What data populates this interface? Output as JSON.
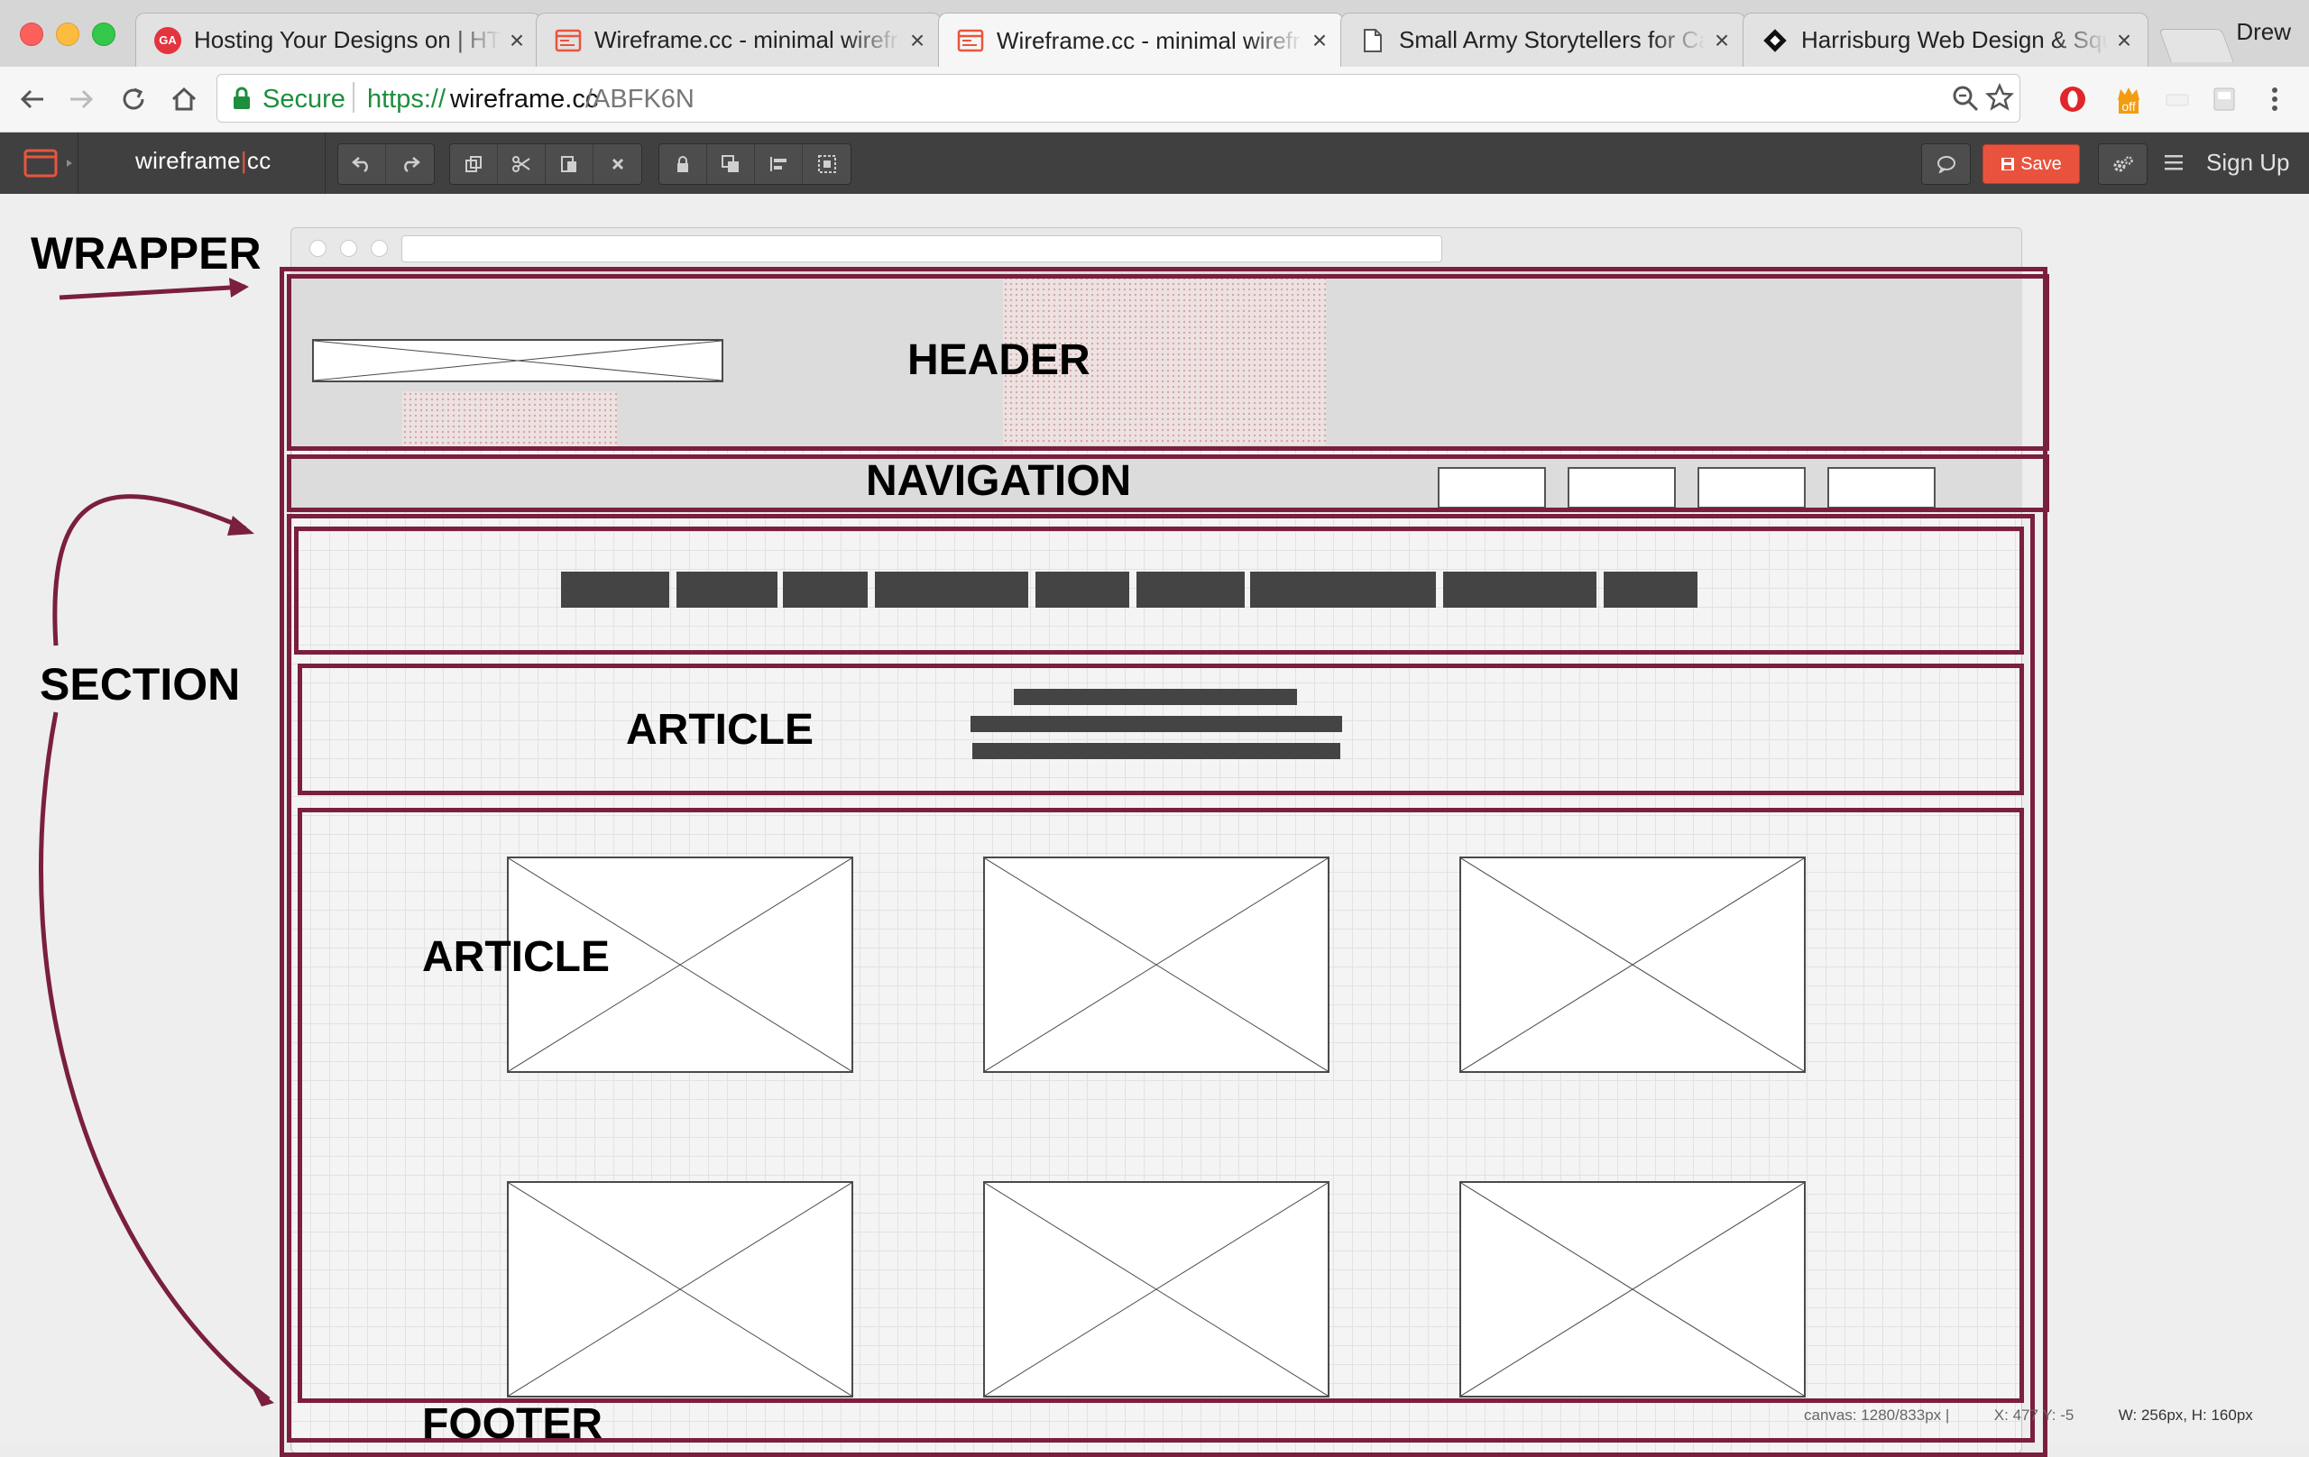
{
  "tabs": [
    {
      "title": "Hosting Your Designs on | HTML",
      "icon": "ga-icon",
      "icon_text": "GA"
    },
    {
      "title": "Wireframe.cc - minimal wireframing",
      "icon": "wireframe-favicon"
    },
    {
      "title": "Wireframe.cc - minimal wireframing",
      "icon": "wireframe-favicon",
      "active": true
    },
    {
      "title": "Small Army Storytellers for Causes",
      "icon": "document-icon"
    },
    {
      "title": "Harrisburg Web Design & Squarespace",
      "icon": "diamond-icon"
    }
  ],
  "profile_name": "Drew",
  "address": {
    "secure_label": "Secure",
    "scheme": "https://",
    "host": "wireframe.cc",
    "path": "/ABFK6N"
  },
  "extensions": {
    "badge_text": "off"
  },
  "app": {
    "logo_left": "wireframe",
    "logo_sep": "|",
    "logo_right": "cc",
    "save_label": "Save",
    "signup_label": "Sign Up"
  },
  "annotations": {
    "wrapper": "WRAPPER",
    "header": "HEADER",
    "navigation": "NAVIGATION",
    "section": "SECTION",
    "article_1": "ARTICLE",
    "article_2": "ARTICLE",
    "footer": "FOOTER"
  },
  "status": {
    "canvas": "canvas: 1280/833px |",
    "coords": "X: 477 Y: -5",
    "dims": "W: 256px, H: 160px"
  },
  "colors": {
    "annotation": "#7a1f3d",
    "save_button": "#e9533d",
    "app_bar": "#404040",
    "secure_green": "#1e8e3e"
  }
}
